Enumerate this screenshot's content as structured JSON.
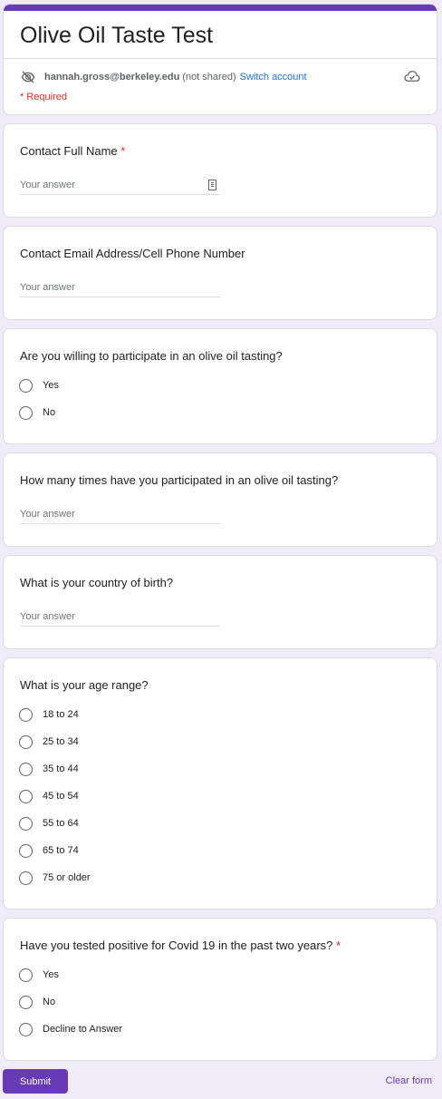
{
  "form": {
    "title": "Olive Oil Taste Test",
    "account_email": "hannah.gross@berkeley.edu",
    "account_note": "(not shared)",
    "switch_account": "Switch account",
    "required_note": "* Required"
  },
  "questions": [
    {
      "title": "Contact Full Name",
      "required_mark": "*",
      "placeholder": "Your answer"
    },
    {
      "title": "Contact Email Address/Cell Phone Number",
      "placeholder": "Your answer"
    },
    {
      "title": "Are you willing to participate in an olive oil tasting?",
      "options": [
        "Yes",
        "No"
      ]
    },
    {
      "title": "How many times have you participated in an olive oil tasting?",
      "placeholder": "Your answer"
    },
    {
      "title": "What is your country of birth?",
      "placeholder": "Your answer"
    },
    {
      "title": "What is your age range?",
      "options": [
        "18 to 24",
        "25 to 34",
        "35 to 44",
        "45 to 54",
        "55 to 64",
        "65 to 74",
        "75 or older"
      ]
    },
    {
      "title": "Have you tested positive for Covid 19 in the past two years?",
      "required_mark": "*",
      "options": [
        "Yes",
        "No",
        "Decline to Answer"
      ]
    }
  ],
  "footer": {
    "submit": "Submit",
    "clear": "Clear form"
  },
  "colors": {
    "accent": "#673ab7",
    "background": "#f0ebf8",
    "required": "#d93025",
    "link": "#1a73e8"
  },
  "icons": [
    "visibility-off-icon",
    "cloud-done-icon",
    "contact-card-icon"
  ]
}
